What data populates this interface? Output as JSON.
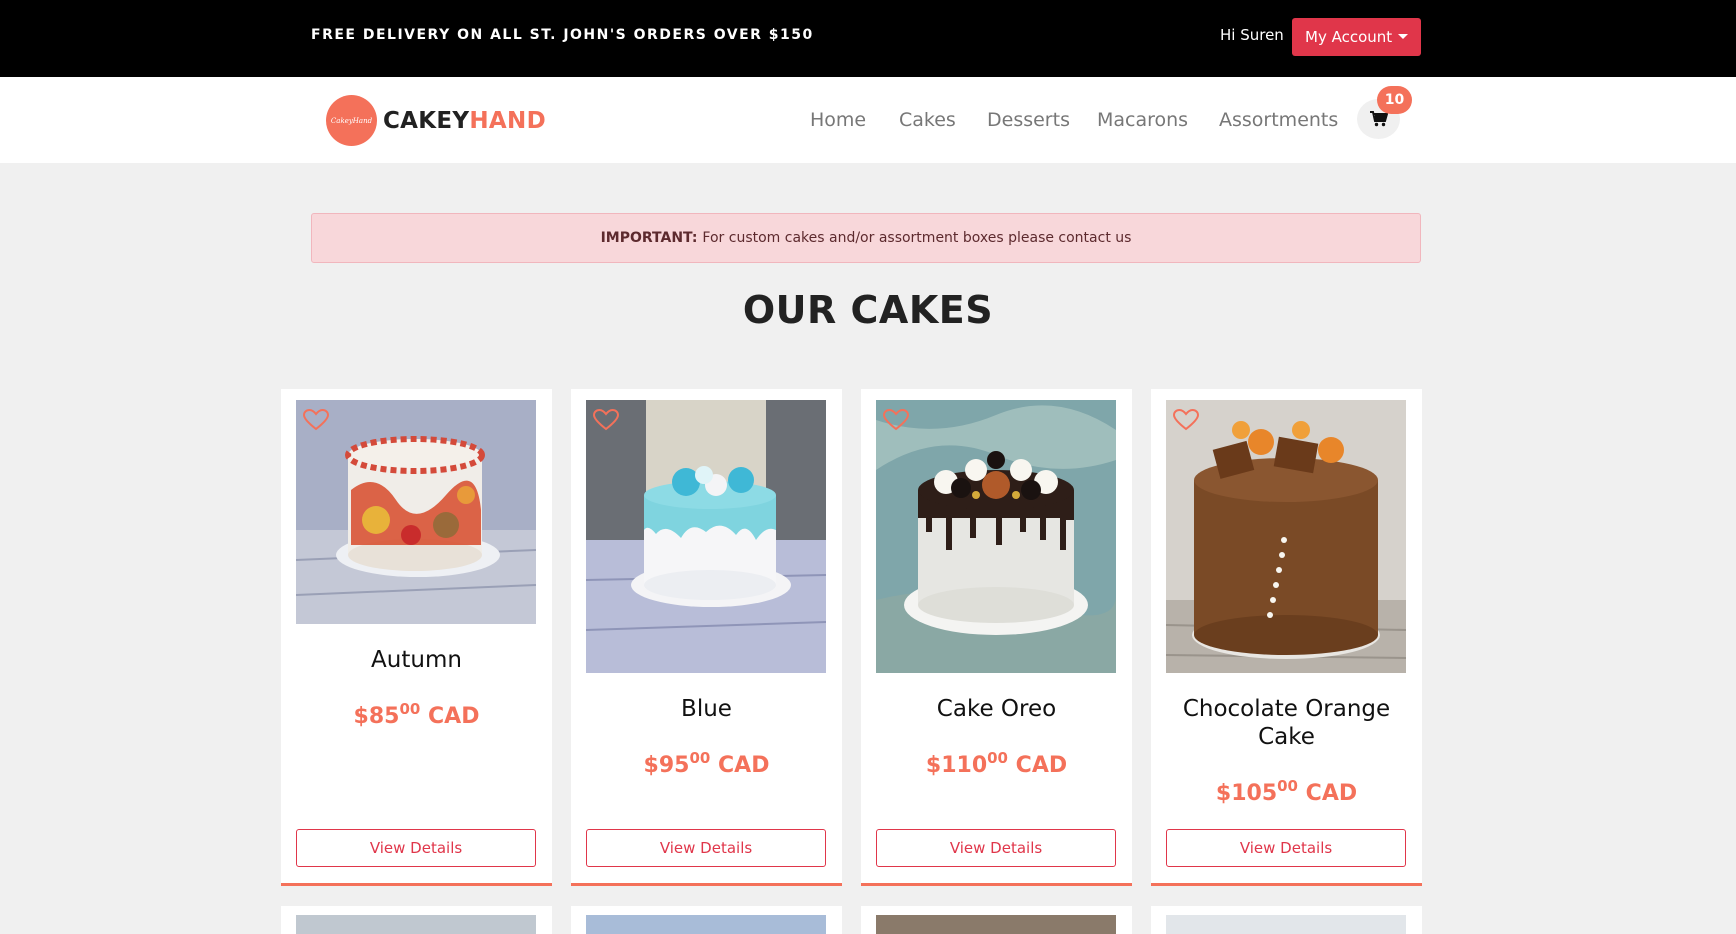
{
  "topbar": {
    "promo": "FREE DELIVERY ON ALL ST. JOHN'S ORDERS OVER $150",
    "greeting": "Hi Suren",
    "account_label": "My Account"
  },
  "brand": {
    "logo_text": "CakeyHand",
    "name_part1": "CAKEY",
    "name_part2": "HAND",
    "accent": "#f4715a"
  },
  "nav": {
    "items": [
      "Home",
      "Cakes",
      "Desserts",
      "Macarons",
      "Assortments"
    ],
    "cart_count": "10"
  },
  "alert": {
    "strong": "IMPORTANT:",
    "text": "For custom cakes and/or assortment boxes please contact us"
  },
  "section_title": "OUR CAKES",
  "products": [
    {
      "name": "Autumn",
      "price_dollars": "$85",
      "price_cents": "00",
      "currency": "CAD",
      "button": "View Details"
    },
    {
      "name": "Blue",
      "price_dollars": "$95",
      "price_cents": "00",
      "currency": "CAD",
      "button": "View Details"
    },
    {
      "name": "Cake Oreo",
      "price_dollars": "$110",
      "price_cents": "00",
      "currency": "CAD",
      "button": "View Details"
    },
    {
      "name": "Chocolate Orange Cake",
      "price_dollars": "$105",
      "price_cents": "00",
      "currency": "CAD",
      "button": "View Details"
    }
  ],
  "colors": {
    "account_button": "#e0364a",
    "alert_bg": "#f8d7da",
    "page_bg": "#f0f0f0"
  }
}
